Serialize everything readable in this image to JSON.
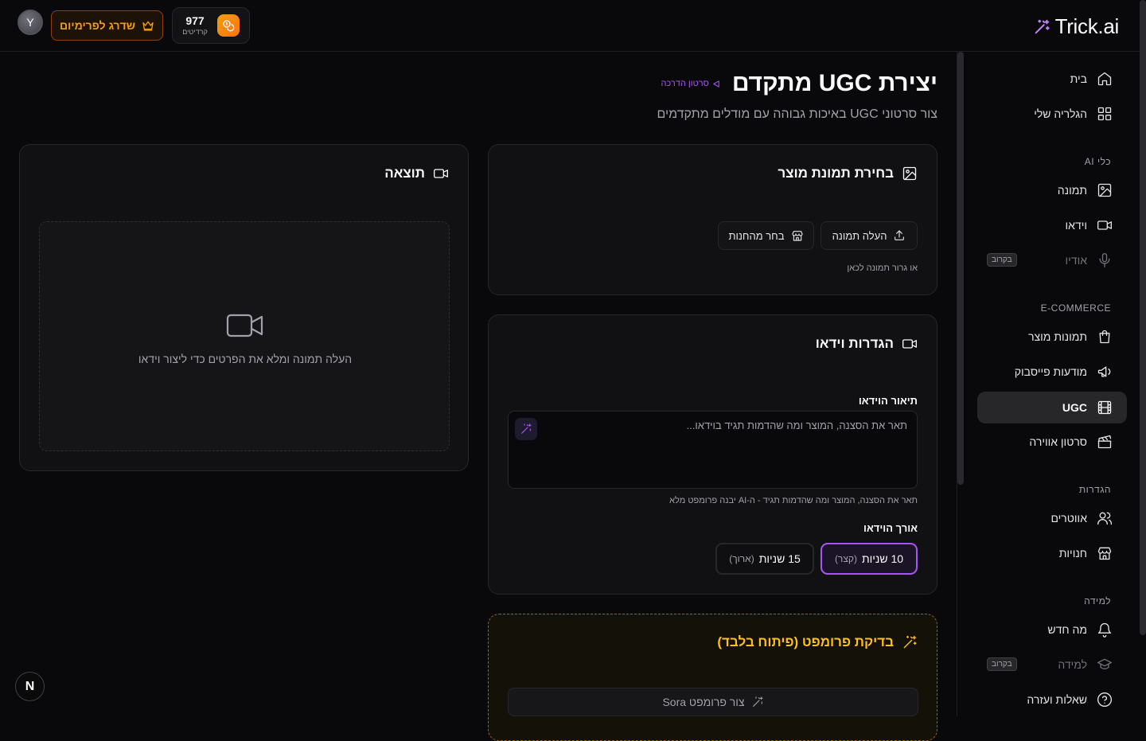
{
  "header": {
    "logo_text": "Trick.ai",
    "credits": {
      "count": "977",
      "label": "קרדיטים"
    },
    "upgrade_label": "שדרג לפרימיום",
    "avatar_letter": "Y"
  },
  "sidebar": {
    "home": "בית",
    "gallery": "הגלריה שלי",
    "section_ai": "כלי AI",
    "image": "תמונה",
    "video": "וידאו",
    "audio": "אודיו",
    "audio_badge": "בקרוב",
    "section_ecommerce": "E-COMMERCE",
    "product_images": "תמונות מוצר",
    "facebook_ads": "מודעות פייסבוק",
    "ugc": "UGC",
    "aerial_video": "סרטון אווירה",
    "section_settings": "הגדרות",
    "avatars": "אווטרים",
    "stores": "חנויות",
    "section_learning": "למידה",
    "whats_new": "מה חדש",
    "learning": "למידה",
    "learning_badge": "בקרוב",
    "help": "שאלות ועזרה"
  },
  "page": {
    "title": "יצירת UGC מתקדם",
    "tutorial_link": "סרטון הדרכה",
    "subtitle": "צור סרטוני UGC באיכות גבוהה עם מודלים מתקדמים"
  },
  "product_card": {
    "title": "בחירת תמונת מוצר",
    "upload_label": "העלה תמונה",
    "store_label": "בחר מהחנות",
    "drag_hint": "או גרור תמונה לכאן"
  },
  "settings_card": {
    "title": "הגדרות וידאו",
    "desc_label": "תיאור הוידאו",
    "desc_placeholder": "תאר את הסצנה, המוצר ומה שהדמות תגיד בוידאו...",
    "desc_hint": "תאר את הסצנה, המוצר ומה שהדמות תגיד - ה-AI יבנה פרומפט מלא",
    "length_label": "אורך הוידאו",
    "options": [
      {
        "main": "10 שניות",
        "sub": "(קצר)",
        "selected": true
      },
      {
        "main": "15 שניות",
        "sub": "(ארוך)",
        "selected": false
      }
    ]
  },
  "output_card": {
    "title": "תוצאה",
    "empty_text": "העלה תמונה ומלא את הפרטים כדי ליצור וידאו"
  },
  "dev_card": {
    "title": "בדיקת פרומפט (פיתוח בלבד)",
    "button_label": "צור פרומפט Sora"
  },
  "colors": {
    "accent": "#a855f7",
    "warning": "#fbbf24",
    "background": "#09090b"
  },
  "footer": {
    "next_letter": "N"
  }
}
